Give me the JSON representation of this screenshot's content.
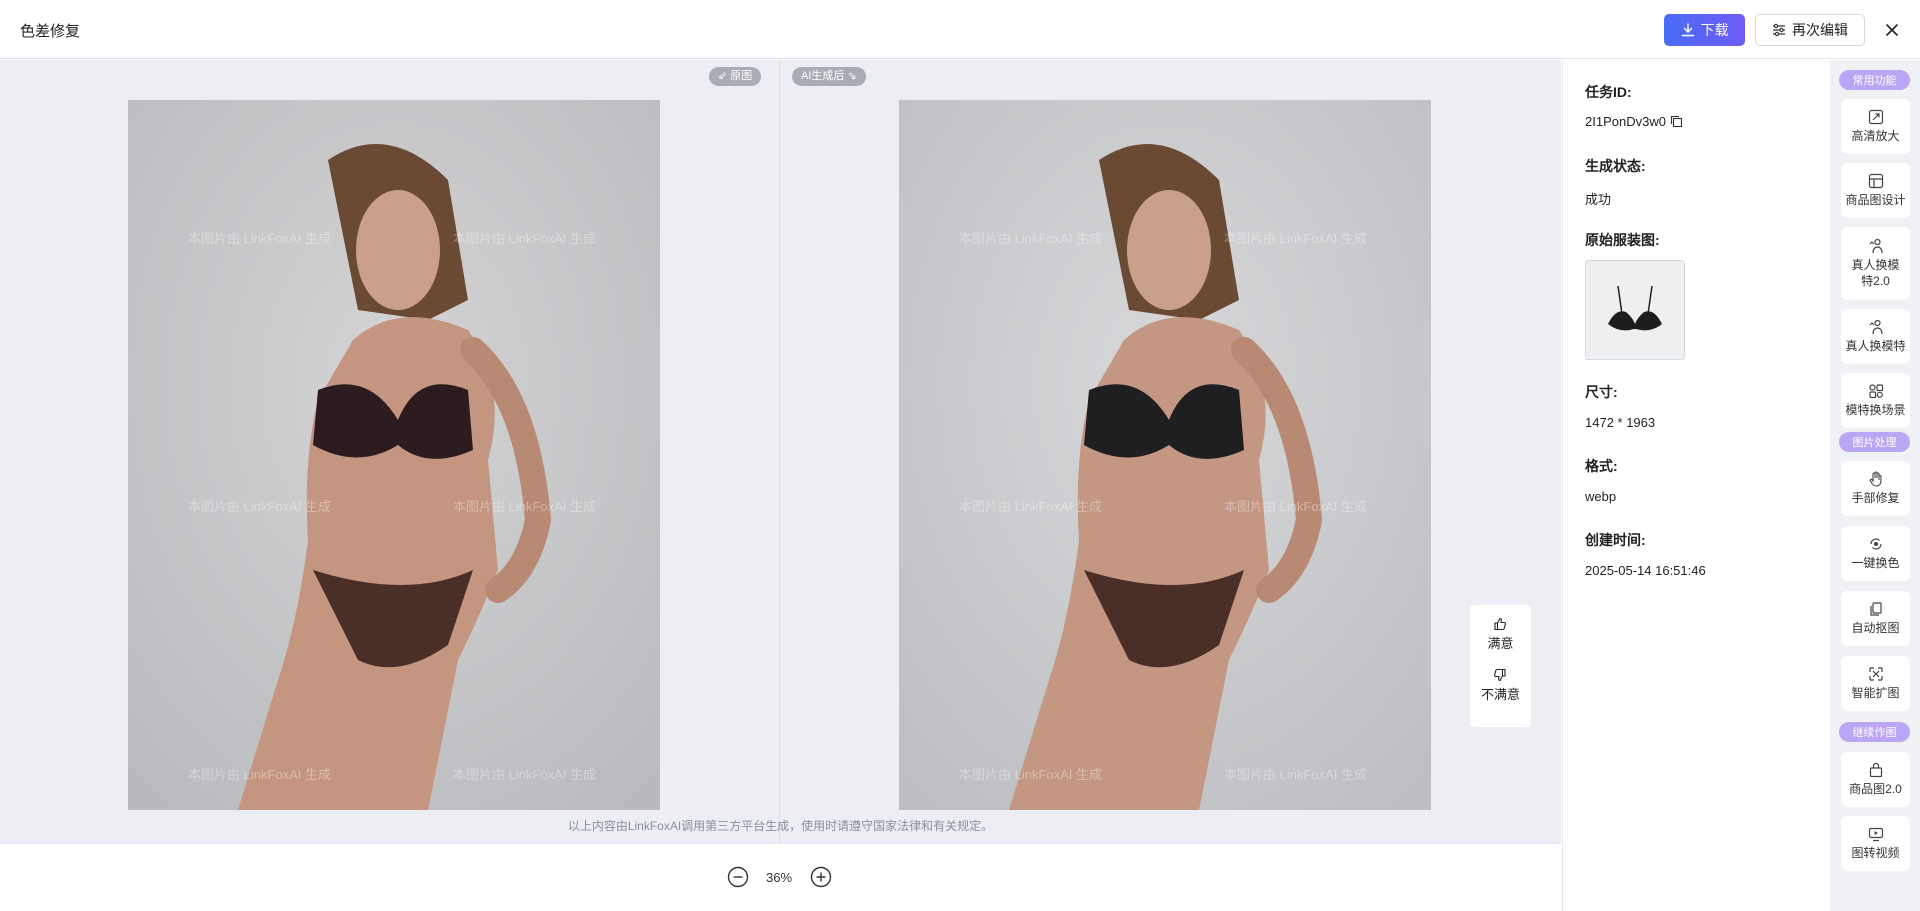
{
  "header": {
    "title": "色差修复",
    "download_label": "下载",
    "edit_label": "再次编辑"
  },
  "compare": {
    "original_tag": "原图",
    "ai_tag": "AI生成后",
    "watermark": "本图片由 LinkFoxAI 生成",
    "disclaimer": "以上内容由LinkFoxAI调用第三方平台生成，使用时请遵守国家法律和有关规定。"
  },
  "feedback": {
    "like_label": "满意",
    "dislike_label": "不满意"
  },
  "zoom": {
    "value": "36%"
  },
  "info": {
    "task_id_label": "任务ID:",
    "task_id_value": "2I1PonDv3w0",
    "status_label": "生成状态:",
    "status_value": "成功",
    "original_garment_label": "原始服装图:",
    "size_label": "尺寸:",
    "size_value": "1472 * 1963",
    "format_label": "格式:",
    "format_value": "webp",
    "created_label": "创建时间:",
    "created_value": "2025-05-14 16:51:46"
  },
  "tools": {
    "groups": [
      {
        "label": "常用功能"
      },
      {
        "label": "图片处理"
      },
      {
        "label": "继续作图"
      }
    ],
    "items": [
      {
        "label": "高清放大",
        "icon": "upscale-icon"
      },
      {
        "label": "商品图设计",
        "icon": "layout-icon"
      },
      {
        "label": "真人换模特2.0",
        "icon": "model-swap-icon"
      },
      {
        "label": "真人换模特",
        "icon": "model-swap-icon"
      },
      {
        "label": "模特换场景",
        "icon": "scene-icon"
      },
      {
        "label": "手部修复",
        "icon": "hand-icon"
      },
      {
        "label": "一键换色",
        "icon": "recolor-icon"
      },
      {
        "label": "自动抠图",
        "icon": "cutout-icon"
      },
      {
        "label": "智能扩图",
        "icon": "expand-icon"
      },
      {
        "label": "商品图2.0",
        "icon": "bag-icon"
      },
      {
        "label": "图转视频",
        "icon": "video-icon"
      }
    ]
  },
  "colors": {
    "accent": "#5b63f6",
    "pill": "#b9a6f5",
    "canvas": "#eceef3"
  }
}
